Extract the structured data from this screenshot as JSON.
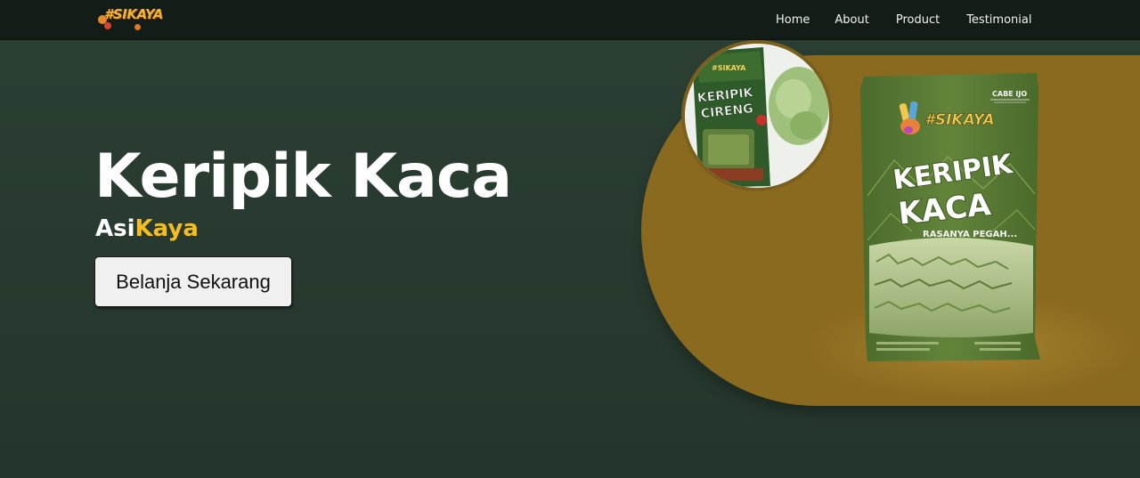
{
  "brand": {
    "logo_text": "#SIKAYA"
  },
  "nav": {
    "items": [
      {
        "label": "Home"
      },
      {
        "label": "About"
      },
      {
        "label": "Product"
      },
      {
        "label": "Testimonial"
      }
    ]
  },
  "hero": {
    "title": "Keripik Kaca",
    "subtitle_part1": "Asi",
    "subtitle_part2": "Kaya",
    "cta_label": "Belanja Sekarang"
  },
  "products": {
    "small": {
      "brand": "#SIKAYA",
      "line1": "KERIPIK",
      "line2": "CIRENG"
    },
    "main": {
      "brand": "#SIKAYA",
      "variant": "CABE IJO",
      "line1": "KERIPIK",
      "line2": "KACA",
      "tagline": "RASANYA PEGAH..."
    }
  },
  "colors": {
    "nav_bg": "#141c17",
    "hero_bg": "#2a3c31",
    "accent_yellow": "#f5bd1f",
    "mustard": "#8a6a1f",
    "pack_green": "#5b7a34"
  }
}
